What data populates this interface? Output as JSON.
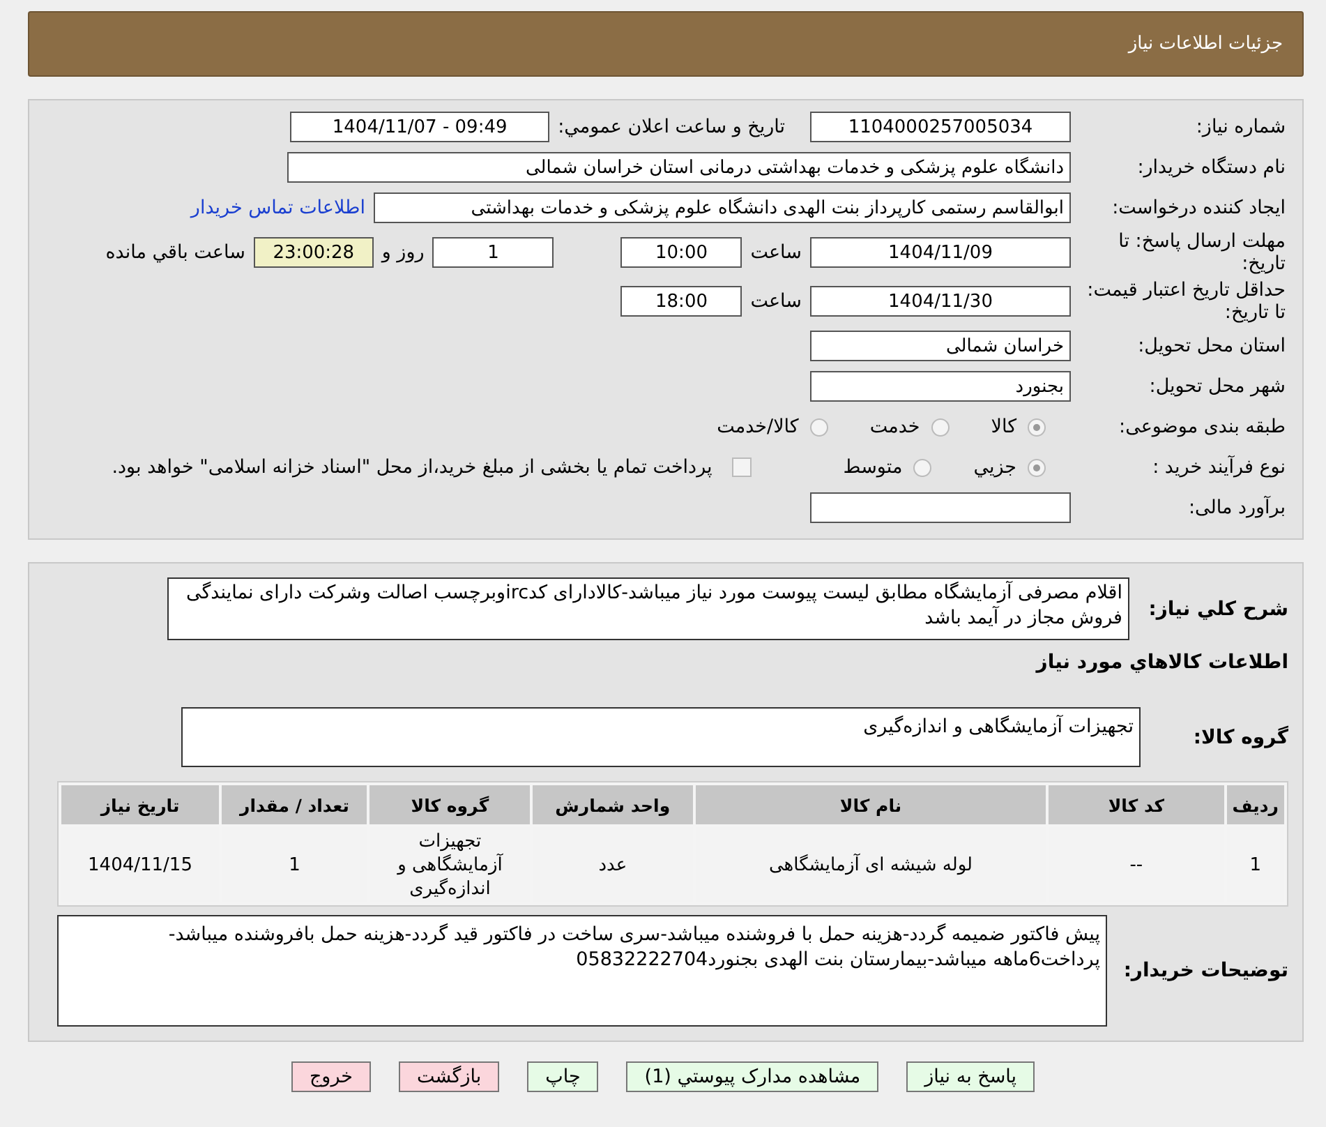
{
  "header": {
    "title": "جزئیات اطلاعات نیاز"
  },
  "details": {
    "need_number": {
      "label": "شماره نیاز:",
      "value": "1104000257005034"
    },
    "announce": {
      "label": "تاریخ و ساعت اعلان عمومي:",
      "value": "1404/11/07 - 09:49"
    },
    "buyer": {
      "label": "نام دستگاه خریدار:",
      "value": "دانشگاه علوم پزشکی و خدمات بهداشتی درمانی استان خراسان شمالی"
    },
    "creator": {
      "label": "ایجاد کننده درخواست:",
      "value": "ابوالقاسم رستمی کارپرداز بنت الهدی دانشگاه علوم پزشکی و خدمات بهداشتی",
      "link": "اطلاعات تماس خریدار"
    },
    "deadline": {
      "label": "مهلت ارسال پاسخ: تا تاریخ:",
      "date": "1404/11/09",
      "time_label": "ساعت",
      "time": "10:00",
      "days": "1",
      "days_label": "روز و",
      "remaining": "23:00:28",
      "remaining_label": "ساعت باقي مانده"
    },
    "validity": {
      "label": "حداقل تاریخ اعتبار قیمت: تا تاریخ:",
      "date": "1404/11/30",
      "time_label": "ساعت",
      "time": "18:00"
    },
    "province": {
      "label": "استان محل تحویل:",
      "value": "خراسان شمالی"
    },
    "city": {
      "label": "شهر محل تحویل:",
      "value": "بجنورد"
    },
    "category": {
      "label": "طبقه بندی موضوعی:",
      "options": [
        {
          "label": "کالا",
          "selected": true
        },
        {
          "label": "خدمت",
          "selected": false
        },
        {
          "label": "کالا/خدمت",
          "selected": false
        }
      ]
    },
    "process": {
      "label": "نوع فرآیند خرید :",
      "options": [
        {
          "label": "جزيي",
          "selected": true
        },
        {
          "label": "متوسط",
          "selected": false
        }
      ],
      "treasury": {
        "label": "پرداخت تمام یا بخشی از مبلغ خرید،از محل \"اسناد خزانه اسلامی\" خواهد بود.",
        "checked": false
      }
    },
    "estimate": {
      "label": "برآورد مالی:"
    }
  },
  "needs": {
    "summary": {
      "label": "شرح کلي نیاز:",
      "value": "اقلام مصرفی آزمایشگاه مطابق لیست پیوست مورد نیاز میباشد-کالادارای کدircوبرچسب اصالت وشرکت دارای نمایندگی فروش مجاز در آیمد باشد"
    },
    "section_title": "اطلاعات کالاهاي مورد نیاز",
    "group": {
      "label": "گروه کالا:",
      "value": "تجهیزات آزمایشگاهی و اندازه‌گیری"
    },
    "table": {
      "columns": [
        "ردیف",
        "کد کالا",
        "نام کالا",
        "واحد شمارش",
        "گروه کالا",
        "تعداد / مقدار",
        "تاریخ نیاز"
      ],
      "rows": [
        [
          "1",
          "--",
          "لوله شیشه ای آزمایشگاهی",
          "عدد",
          "تجهیزات آزمایشگاهی و اندازه‌گیری",
          "1",
          "1404/11/15"
        ]
      ]
    },
    "buyer_notes": {
      "label": "توضیحات خریدار:",
      "value": "پیش فاکتور ضمیمه گردد-هزینه حمل با فروشنده میباشد-سری ساخت در فاکتور قید گردد-هزینه حمل بافروشنده میباشد-پرداخت6ماهه میباشد-بیمارستان بنت الهدی بجنورد05832222704"
    }
  },
  "buttons": [
    {
      "label": "پاسخ به نیاز",
      "kind": "normal"
    },
    {
      "label": "مشاهده مدارک پیوستي (1)",
      "kind": "normal"
    },
    {
      "label": "چاپ",
      "kind": "normal"
    },
    {
      "label": "بازگشت",
      "kind": "danger"
    },
    {
      "label": "خروج",
      "kind": "danger"
    }
  ]
}
